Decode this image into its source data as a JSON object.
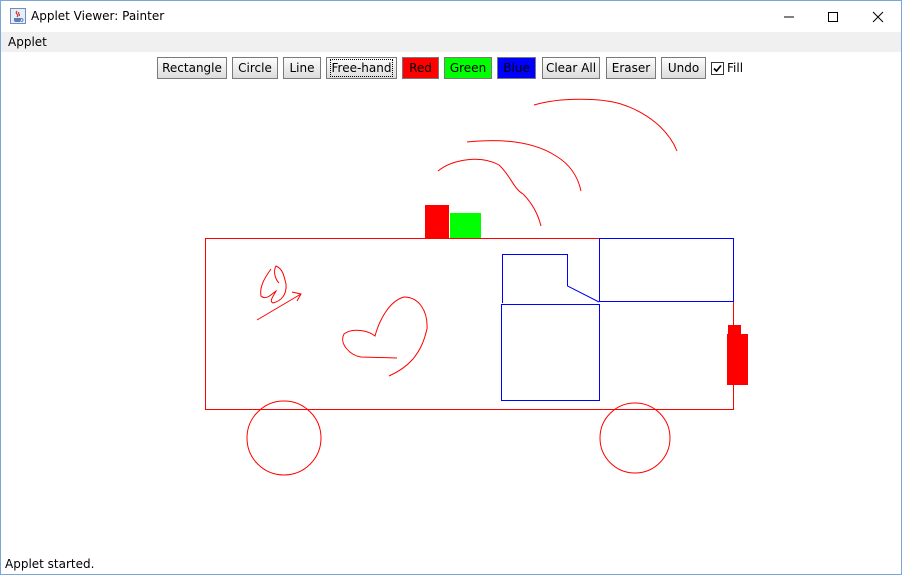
{
  "window": {
    "title": "Applet Viewer: Painter",
    "app_icon": "java-cup-icon",
    "controls": [
      "minimize-icon",
      "maximize-icon",
      "close-icon"
    ]
  },
  "menubar": {
    "items": [
      "Applet"
    ]
  },
  "toolbar": {
    "buttons": [
      {
        "label": "Rectangle"
      },
      {
        "label": "Circle"
      },
      {
        "label": "Line"
      },
      {
        "label": "Free-hand"
      },
      {
        "label": "Red",
        "color": "#ff0000"
      },
      {
        "label": "Green",
        "color": "#00ff00"
      },
      {
        "label": "Blue",
        "color": "#0000ff"
      },
      {
        "label": "Clear All"
      },
      {
        "label": "Eraser"
      },
      {
        "label": "Undo"
      }
    ],
    "fill": {
      "label": "Fill",
      "checked": true
    }
  },
  "status": {
    "text": "Applet started."
  },
  "colors": {
    "red": "#ff0000",
    "green": "#00ff00",
    "blue": "#0000ff",
    "window_border": "#7aa7d8"
  }
}
